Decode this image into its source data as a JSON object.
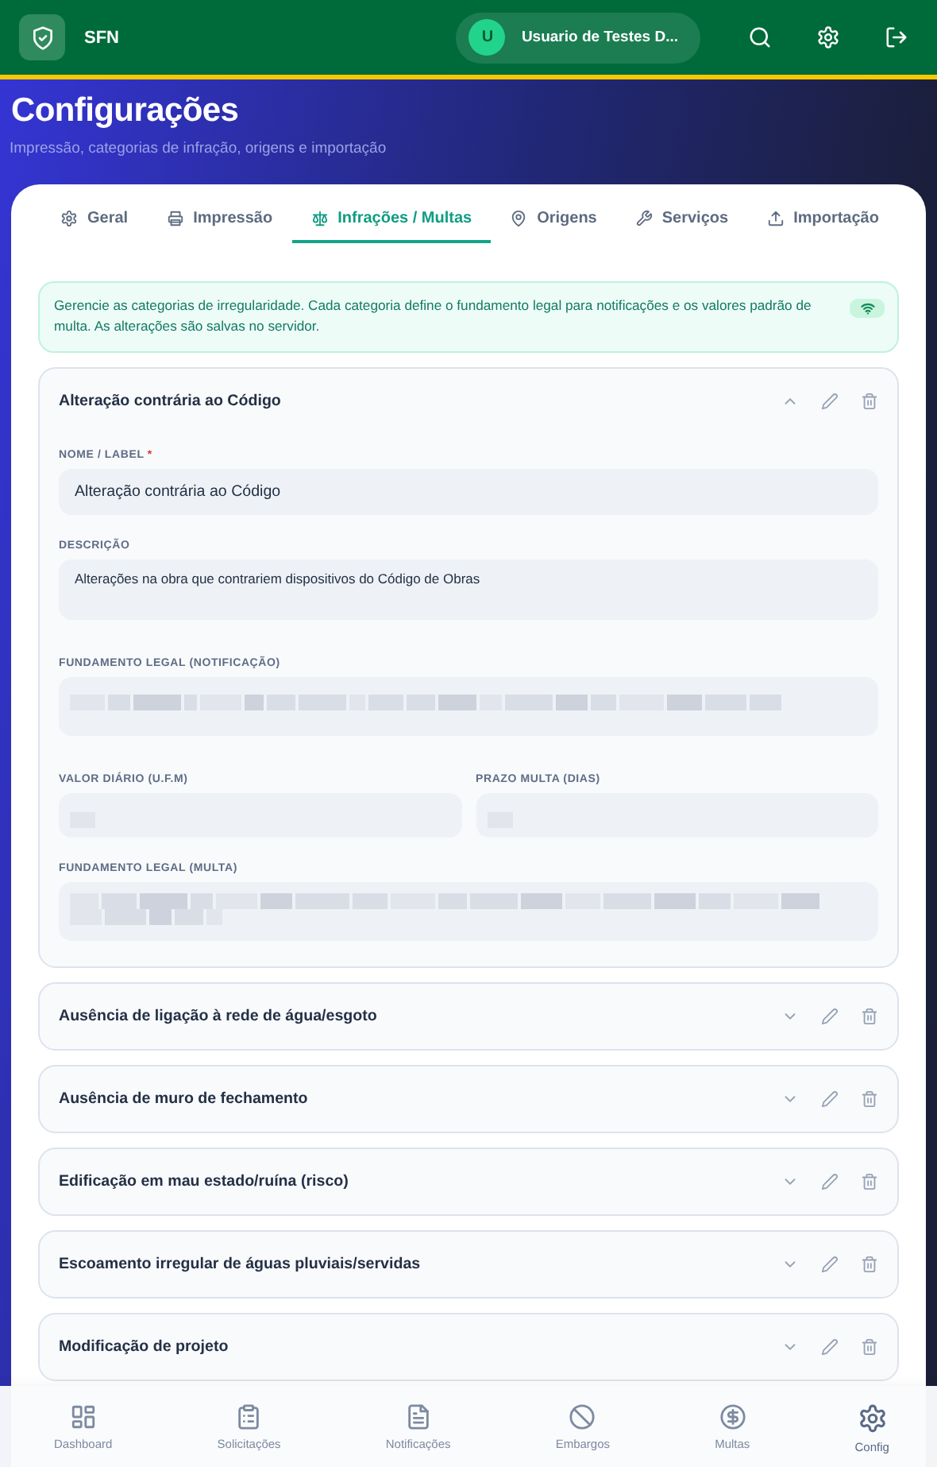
{
  "app": {
    "name": "SFN",
    "user_initial": "U",
    "user_name": "Usuario de Testes D..."
  },
  "page": {
    "title": "Configurações",
    "subtitle": "Impressão, categorias de infração, origens e importação"
  },
  "tabs": [
    {
      "label": "Geral",
      "selected": false
    },
    {
      "label": "Impressão",
      "selected": false
    },
    {
      "label": "Infrações / Multas",
      "selected": true
    },
    {
      "label": "Origens",
      "selected": false
    },
    {
      "label": "Serviços",
      "selected": false
    },
    {
      "label": "Importação",
      "selected": false
    }
  ],
  "info": {
    "text": "Gerencie as categorias de irregularidade. Cada categoria define o fundamento legal para notificações e os valores padrão de multa. As alterações são salvas no servidor."
  },
  "categories": [
    {
      "name": "Alteração contrária ao Código",
      "expanded": true,
      "rows": [
        [
          {
            "label": "NOME / LABEL",
            "required_mark": "*",
            "kind": "text",
            "value": "Alteração contrária ao Código"
          }
        ],
        [
          {
            "label": "DESCRIÇÃO",
            "kind": "textarea",
            "value": "Alterações na obra que contrariem dispositivos do Código de Obras"
          }
        ],
        [
          {
            "label": "FUNDAMENTO LEGAL (NOTIFICAÇÃO)",
            "kind": "blurred-line"
          }
        ],
        [
          {
            "label": "VALOR DIÁRIO (U.F.M)",
            "kind": "blurred-short"
          },
          {
            "label": "PRAZO MULTA (DIAS)",
            "kind": "blurred-short"
          }
        ],
        [
          {
            "label": "FUNDAMENTO LEGAL (MULTA)",
            "kind": "blurred-paragraph"
          }
        ]
      ]
    },
    {
      "name": "Ausência de ligação à rede de água/esgoto",
      "expanded": false
    },
    {
      "name": "Ausência de muro de fechamento",
      "expanded": false
    },
    {
      "name": "Edificação em mau estado/ruína (risco)",
      "expanded": false
    },
    {
      "name": "Escoamento irregular de águas pluviais/servidas",
      "expanded": false
    },
    {
      "name": "Modificação de projeto",
      "expanded": false
    }
  ],
  "bottom_nav": [
    {
      "label": "Dashboard",
      "selected": false
    },
    {
      "label": "Solicitações",
      "selected": false
    },
    {
      "label": "Notificações",
      "selected": false
    },
    {
      "label": "Embargos",
      "selected": false
    },
    {
      "label": "Multas",
      "selected": false
    },
    {
      "label": "Config",
      "selected": true
    }
  ]
}
